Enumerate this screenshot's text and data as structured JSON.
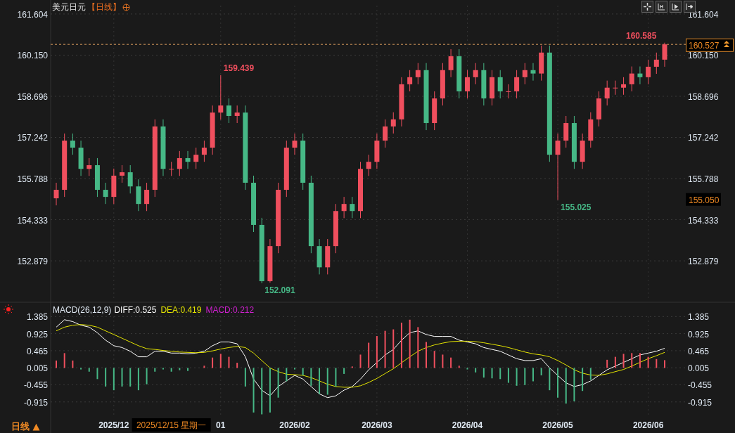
{
  "header": {
    "title": "美元日元",
    "period": "【日线】"
  },
  "price_chart": {
    "current_price": "160.527",
    "crosshair_price": "155.050",
    "chart_data": {
      "type": "candlestick",
      "grid": true,
      "ylim": [
        151.54,
        161.9
      ],
      "yticks": [
        {
          "value": 161.604,
          "label": "161.604"
        },
        {
          "value": 160.15,
          "label": "160.150"
        },
        {
          "value": 158.696,
          "label": "158.696"
        },
        {
          "value": 157.242,
          "label": "157.242"
        },
        {
          "value": 155.788,
          "label": "155.788"
        },
        {
          "value": 154.333,
          "label": "154.333"
        },
        {
          "value": 152.879,
          "label": "152.879"
        }
      ],
      "categories": [
        null,
        null,
        null,
        null,
        null,
        null,
        null,
        null,
        null,
        null,
        null,
        null,
        null,
        null,
        null,
        null,
        null,
        null,
        null,
        null,
        null,
        null,
        null,
        null,
        null,
        null,
        null,
        null,
        null,
        null,
        null,
        null,
        null,
        null,
        null,
        null,
        null,
        null,
        null,
        null,
        null,
        null,
        null,
        null,
        null,
        null,
        null,
        null,
        null,
        null,
        null,
        null,
        null,
        null,
        null,
        null,
        null,
        null,
        null,
        null,
        null,
        null,
        null,
        null,
        null,
        null,
        null,
        null,
        null,
        null,
        null,
        null,
        null,
        null,
        null
      ],
      "ohlc": [
        [
          155.09,
          155.64,
          154.84,
          155.39
        ],
        [
          155.39,
          157.38,
          155.14,
          157.13
        ],
        [
          157.13,
          157.38,
          156.63,
          156.88
        ],
        [
          156.88,
          157.13,
          155.88,
          156.13
        ],
        [
          156.13,
          156.51,
          155.88,
          156.26
        ],
        [
          156.26,
          156.51,
          155.14,
          155.39
        ],
        [
          155.39,
          155.64,
          154.89,
          155.14
        ],
        [
          155.14,
          156.14,
          154.89,
          155.89
        ],
        [
          155.89,
          156.26,
          155.64,
          156.01
        ],
        [
          156.01,
          156.26,
          155.26,
          155.51
        ],
        [
          155.51,
          155.76,
          154.64,
          154.89
        ],
        [
          154.89,
          155.64,
          154.64,
          155.39
        ],
        [
          155.39,
          157.88,
          155.14,
          157.63
        ],
        [
          157.63,
          157.88,
          155.88,
          156.13
        ],
        [
          156.13,
          156.38,
          155.88,
          156.13
        ],
        [
          156.13,
          156.76,
          155.88,
          156.51
        ],
        [
          156.51,
          156.76,
          156.13,
          156.38
        ],
        [
          156.38,
          156.88,
          156.13,
          156.63
        ],
        [
          156.63,
          157.13,
          156.38,
          156.88
        ],
        [
          156.88,
          158.37,
          156.63,
          158.12
        ],
        [
          158.12,
          159.44,
          157.87,
          158.37
        ],
        [
          158.37,
          158.62,
          157.75,
          158.0
        ],
        [
          158.0,
          158.37,
          157.75,
          158.12
        ],
        [
          158.12,
          158.37,
          155.39,
          155.64
        ],
        [
          155.64,
          155.89,
          153.9,
          154.15
        ],
        [
          154.15,
          154.4,
          152.09,
          152.16
        ],
        [
          152.16,
          153.65,
          152.11,
          153.4
        ],
        [
          153.4,
          155.64,
          153.15,
          155.39
        ],
        [
          155.39,
          157.13,
          155.14,
          156.88
        ],
        [
          156.88,
          157.38,
          156.63,
          157.13
        ],
        [
          157.13,
          157.38,
          155.39,
          155.64
        ],
        [
          155.64,
          155.89,
          153.15,
          153.4
        ],
        [
          153.4,
          153.65,
          152.4,
          152.65
        ],
        [
          152.65,
          153.65,
          152.4,
          153.4
        ],
        [
          153.4,
          154.89,
          153.15,
          154.64
        ],
        [
          154.64,
          155.14,
          154.39,
          154.89
        ],
        [
          154.89,
          155.14,
          154.39,
          154.64
        ],
        [
          154.64,
          156.38,
          154.39,
          156.13
        ],
        [
          156.13,
          156.63,
          155.88,
          156.38
        ],
        [
          156.38,
          157.38,
          156.13,
          157.13
        ],
        [
          157.13,
          157.88,
          156.88,
          157.63
        ],
        [
          157.63,
          158.13,
          157.38,
          157.88
        ],
        [
          157.88,
          159.37,
          157.63,
          159.12
        ],
        [
          159.12,
          159.62,
          158.87,
          159.37
        ],
        [
          159.37,
          159.87,
          159.12,
          159.62
        ],
        [
          159.62,
          159.87,
          157.5,
          157.75
        ],
        [
          157.75,
          158.87,
          157.5,
          158.62
        ],
        [
          158.62,
          159.87,
          158.37,
          159.62
        ],
        [
          159.62,
          160.36,
          159.37,
          160.11
        ],
        [
          160.11,
          160.36,
          158.62,
          158.87
        ],
        [
          158.87,
          159.62,
          158.62,
          159.37
        ],
        [
          159.37,
          159.87,
          159.12,
          159.62
        ],
        [
          159.62,
          159.87,
          158.37,
          158.62
        ],
        [
          158.62,
          159.62,
          158.37,
          159.37
        ],
        [
          159.37,
          159.62,
          158.62,
          158.87
        ],
        [
          158.87,
          159.12,
          158.62,
          158.87
        ],
        [
          158.87,
          159.62,
          158.62,
          159.37
        ],
        [
          159.37,
          159.87,
          159.12,
          159.62
        ],
        [
          159.62,
          159.87,
          159.25,
          159.5
        ],
        [
          159.5,
          160.49,
          159.25,
          160.24
        ],
        [
          160.24,
          160.49,
          156.38,
          156.63
        ],
        [
          156.63,
          157.38,
          155.03,
          157.13
        ],
        [
          157.13,
          158.0,
          156.88,
          157.75
        ],
        [
          157.75,
          158.0,
          156.13,
          156.38
        ],
        [
          156.38,
          157.38,
          156.13,
          157.13
        ],
        [
          157.13,
          158.13,
          156.88,
          157.88
        ],
        [
          157.88,
          158.87,
          157.63,
          158.62
        ],
        [
          158.62,
          159.25,
          158.37,
          159.0
        ],
        [
          159.0,
          159.25,
          158.75,
          159.0
        ],
        [
          159.0,
          159.37,
          158.75,
          159.12
        ],
        [
          159.12,
          159.75,
          158.87,
          159.5
        ],
        [
          159.5,
          159.75,
          159.12,
          159.37
        ],
        [
          159.37,
          159.99,
          159.12,
          159.74
        ],
        [
          159.74,
          160.24,
          159.49,
          159.99
        ],
        [
          159.99,
          160.59,
          159.74,
          160.53
        ]
      ],
      "ref_lines": [
        {
          "axis": "y",
          "value": 160.53
        }
      ],
      "annotations": [
        "159.439",
        "152.091",
        "155.025",
        "160.585"
      ]
    }
  },
  "macd": {
    "title": "MACD(26,12,9)",
    "diff": "DIFF:0.525",
    "dea": "DEA:0.419",
    "macd": "MACD:0.212",
    "chart_data": {
      "type": "line",
      "grid": true,
      "ylim": [
        -1.26,
        1.77
      ],
      "yticks": [
        {
          "value": 1.385,
          "label": "1.385"
        },
        {
          "value": 0.925,
          "label": "0.925"
        },
        {
          "value": 0.465,
          "label": "0.465"
        },
        {
          "value": 0.005,
          "label": "0.005"
        },
        {
          "value": -0.455,
          "label": "-0.455"
        },
        {
          "value": -0.915,
          "label": "-0.915"
        }
      ],
      "categories": [
        null,
        null,
        null,
        null,
        null,
        null,
        null,
        "2025/12",
        null,
        null,
        null,
        null,
        null,
        null,
        null,
        null,
        null,
        null,
        null,
        null,
        "01",
        null,
        null,
        null,
        null,
        null,
        null,
        null,
        null,
        "2026/02",
        null,
        null,
        null,
        null,
        null,
        null,
        null,
        null,
        null,
        "2026/03",
        null,
        null,
        null,
        null,
        null,
        null,
        null,
        null,
        null,
        null,
        "2026/04",
        null,
        null,
        null,
        null,
        null,
        null,
        null,
        null,
        null,
        null,
        "2026/05",
        null,
        null,
        null,
        null,
        null,
        null,
        null,
        null,
        null,
        null,
        "2026/06",
        null,
        null
      ],
      "series": [
        {
          "color": "#ffffff",
          "values": [
            1.1,
            1.3,
            1.25,
            1.15,
            1.1,
            0.95,
            0.75,
            0.6,
            0.55,
            0.45,
            0.3,
            0.3,
            0.45,
            0.45,
            0.4,
            0.4,
            0.38,
            0.4,
            0.45,
            0.6,
            0.7,
            0.7,
            0.65,
            0.3,
            -0.3,
            -0.6,
            -0.75,
            -0.5,
            -0.35,
            -0.2,
            -0.3,
            -0.5,
            -0.7,
            -0.8,
            -0.75,
            -0.6,
            -0.5,
            -0.3,
            -0.05,
            0.15,
            0.35,
            0.5,
            0.75,
            0.95,
            1.0,
            0.9,
            0.85,
            0.85,
            0.85,
            0.75,
            0.7,
            0.65,
            0.55,
            0.5,
            0.45,
            0.35,
            0.25,
            0.2,
            0.2,
            0.25,
            0.0,
            -0.2,
            -0.4,
            -0.5,
            -0.45,
            -0.35,
            -0.2,
            -0.05,
            0.05,
            0.15,
            0.25,
            0.35,
            0.4,
            0.45,
            0.53
          ]
        },
        {
          "color": "#e6e600",
          "values": [
            1.0,
            1.1,
            1.15,
            1.17,
            1.15,
            1.1,
            1.0,
            0.9,
            0.8,
            0.7,
            0.6,
            0.52,
            0.5,
            0.47,
            0.45,
            0.43,
            0.42,
            0.41,
            0.42,
            0.46,
            0.51,
            0.55,
            0.58,
            0.55,
            0.4,
            0.2,
            0.0,
            -0.1,
            -0.17,
            -0.18,
            -0.2,
            -0.26,
            -0.35,
            -0.44,
            -0.5,
            -0.52,
            -0.52,
            -0.48,
            -0.39,
            -0.28,
            -0.15,
            -0.02,
            0.14,
            0.3,
            0.45,
            0.55,
            0.62,
            0.67,
            0.71,
            0.72,
            0.72,
            0.71,
            0.68,
            0.64,
            0.6,
            0.55,
            0.49,
            0.43,
            0.38,
            0.35,
            0.3,
            0.2,
            0.08,
            -0.05,
            -0.14,
            -0.19,
            -0.2,
            -0.16,
            -0.1,
            -0.04,
            0.05,
            0.15,
            0.25,
            0.33,
            0.42
          ]
        },
        {
          "type": "bar",
          "colors": [
            "#f04f5e",
            "#f04f5e",
            "#f04f5e",
            "#46b886",
            "#46b886",
            "#46b886",
            "#46b886",
            "#46b886",
            "#46b886",
            "#46b886",
            "#46b886",
            "#46b886",
            "#46b886",
            "#46b886",
            "#46b886",
            "#46b886",
            "#46b886",
            null,
            "#f04f5e",
            "#f04f5e",
            "#f04f5e",
            "#f04f5e",
            "#f04f5e",
            "#46b886",
            "#46b886",
            "#46b886",
            "#46b886",
            "#46b886",
            "#46b886",
            "#46b886",
            "#46b886",
            "#46b886",
            "#46b886",
            "#46b886",
            "#46b886",
            "#46b886",
            "#f04f5e",
            "#f04f5e",
            "#f04f5e",
            "#f04f5e",
            "#f04f5e",
            "#f04f5e",
            "#f04f5e",
            "#f04f5e",
            "#f04f5e",
            "#f04f5e",
            "#f04f5e",
            "#f04f5e",
            "#f04f5e",
            "#f04f5e",
            "#46b886",
            "#46b886",
            "#46b886",
            "#46b886",
            "#46b886",
            "#46b886",
            "#46b886",
            "#46b886",
            "#46b886",
            "#46b886",
            "#46b886",
            "#46b886",
            "#46b886",
            "#46b886",
            "#46b886",
            "#46b886",
            null,
            "#f04f5e",
            "#f04f5e",
            "#f04f5e",
            "#f04f5e",
            "#f04f5e",
            "#f04f5e",
            "#f04f5e",
            "#f04f5e"
          ],
          "values": [
            0.2,
            0.4,
            0.2,
            -0.04,
            -0.1,
            -0.3,
            -0.5,
            -0.6,
            -0.5,
            -0.5,
            -0.6,
            -0.44,
            -0.1,
            -0.04,
            -0.1,
            -0.06,
            -0.08,
            null,
            0.06,
            0.28,
            0.38,
            0.3,
            0.14,
            -0.5,
            -1.2,
            -1.25,
            -1.2,
            -0.8,
            -0.36,
            -0.04,
            -0.2,
            -0.48,
            -0.7,
            -0.72,
            -0.5,
            -0.16,
            0.04,
            0.36,
            0.68,
            0.86,
            1.0,
            1.04,
            1.22,
            1.3,
            1.1,
            0.7,
            0.46,
            0.36,
            0.28,
            0.06,
            -0.04,
            -0.12,
            -0.26,
            -0.28,
            -0.3,
            -0.4,
            -0.48,
            -0.46,
            -0.36,
            -0.2,
            -0.6,
            -0.8,
            -0.96,
            -0.9,
            -0.62,
            -0.32,
            null,
            0.22,
            0.3,
            0.38,
            0.4,
            0.4,
            0.3,
            0.24,
            0.21
          ]
        }
      ]
    }
  },
  "x_axis": {
    "crosshair_date": "2025/12/15 星期一"
  },
  "period_button": "日线 ▲"
}
